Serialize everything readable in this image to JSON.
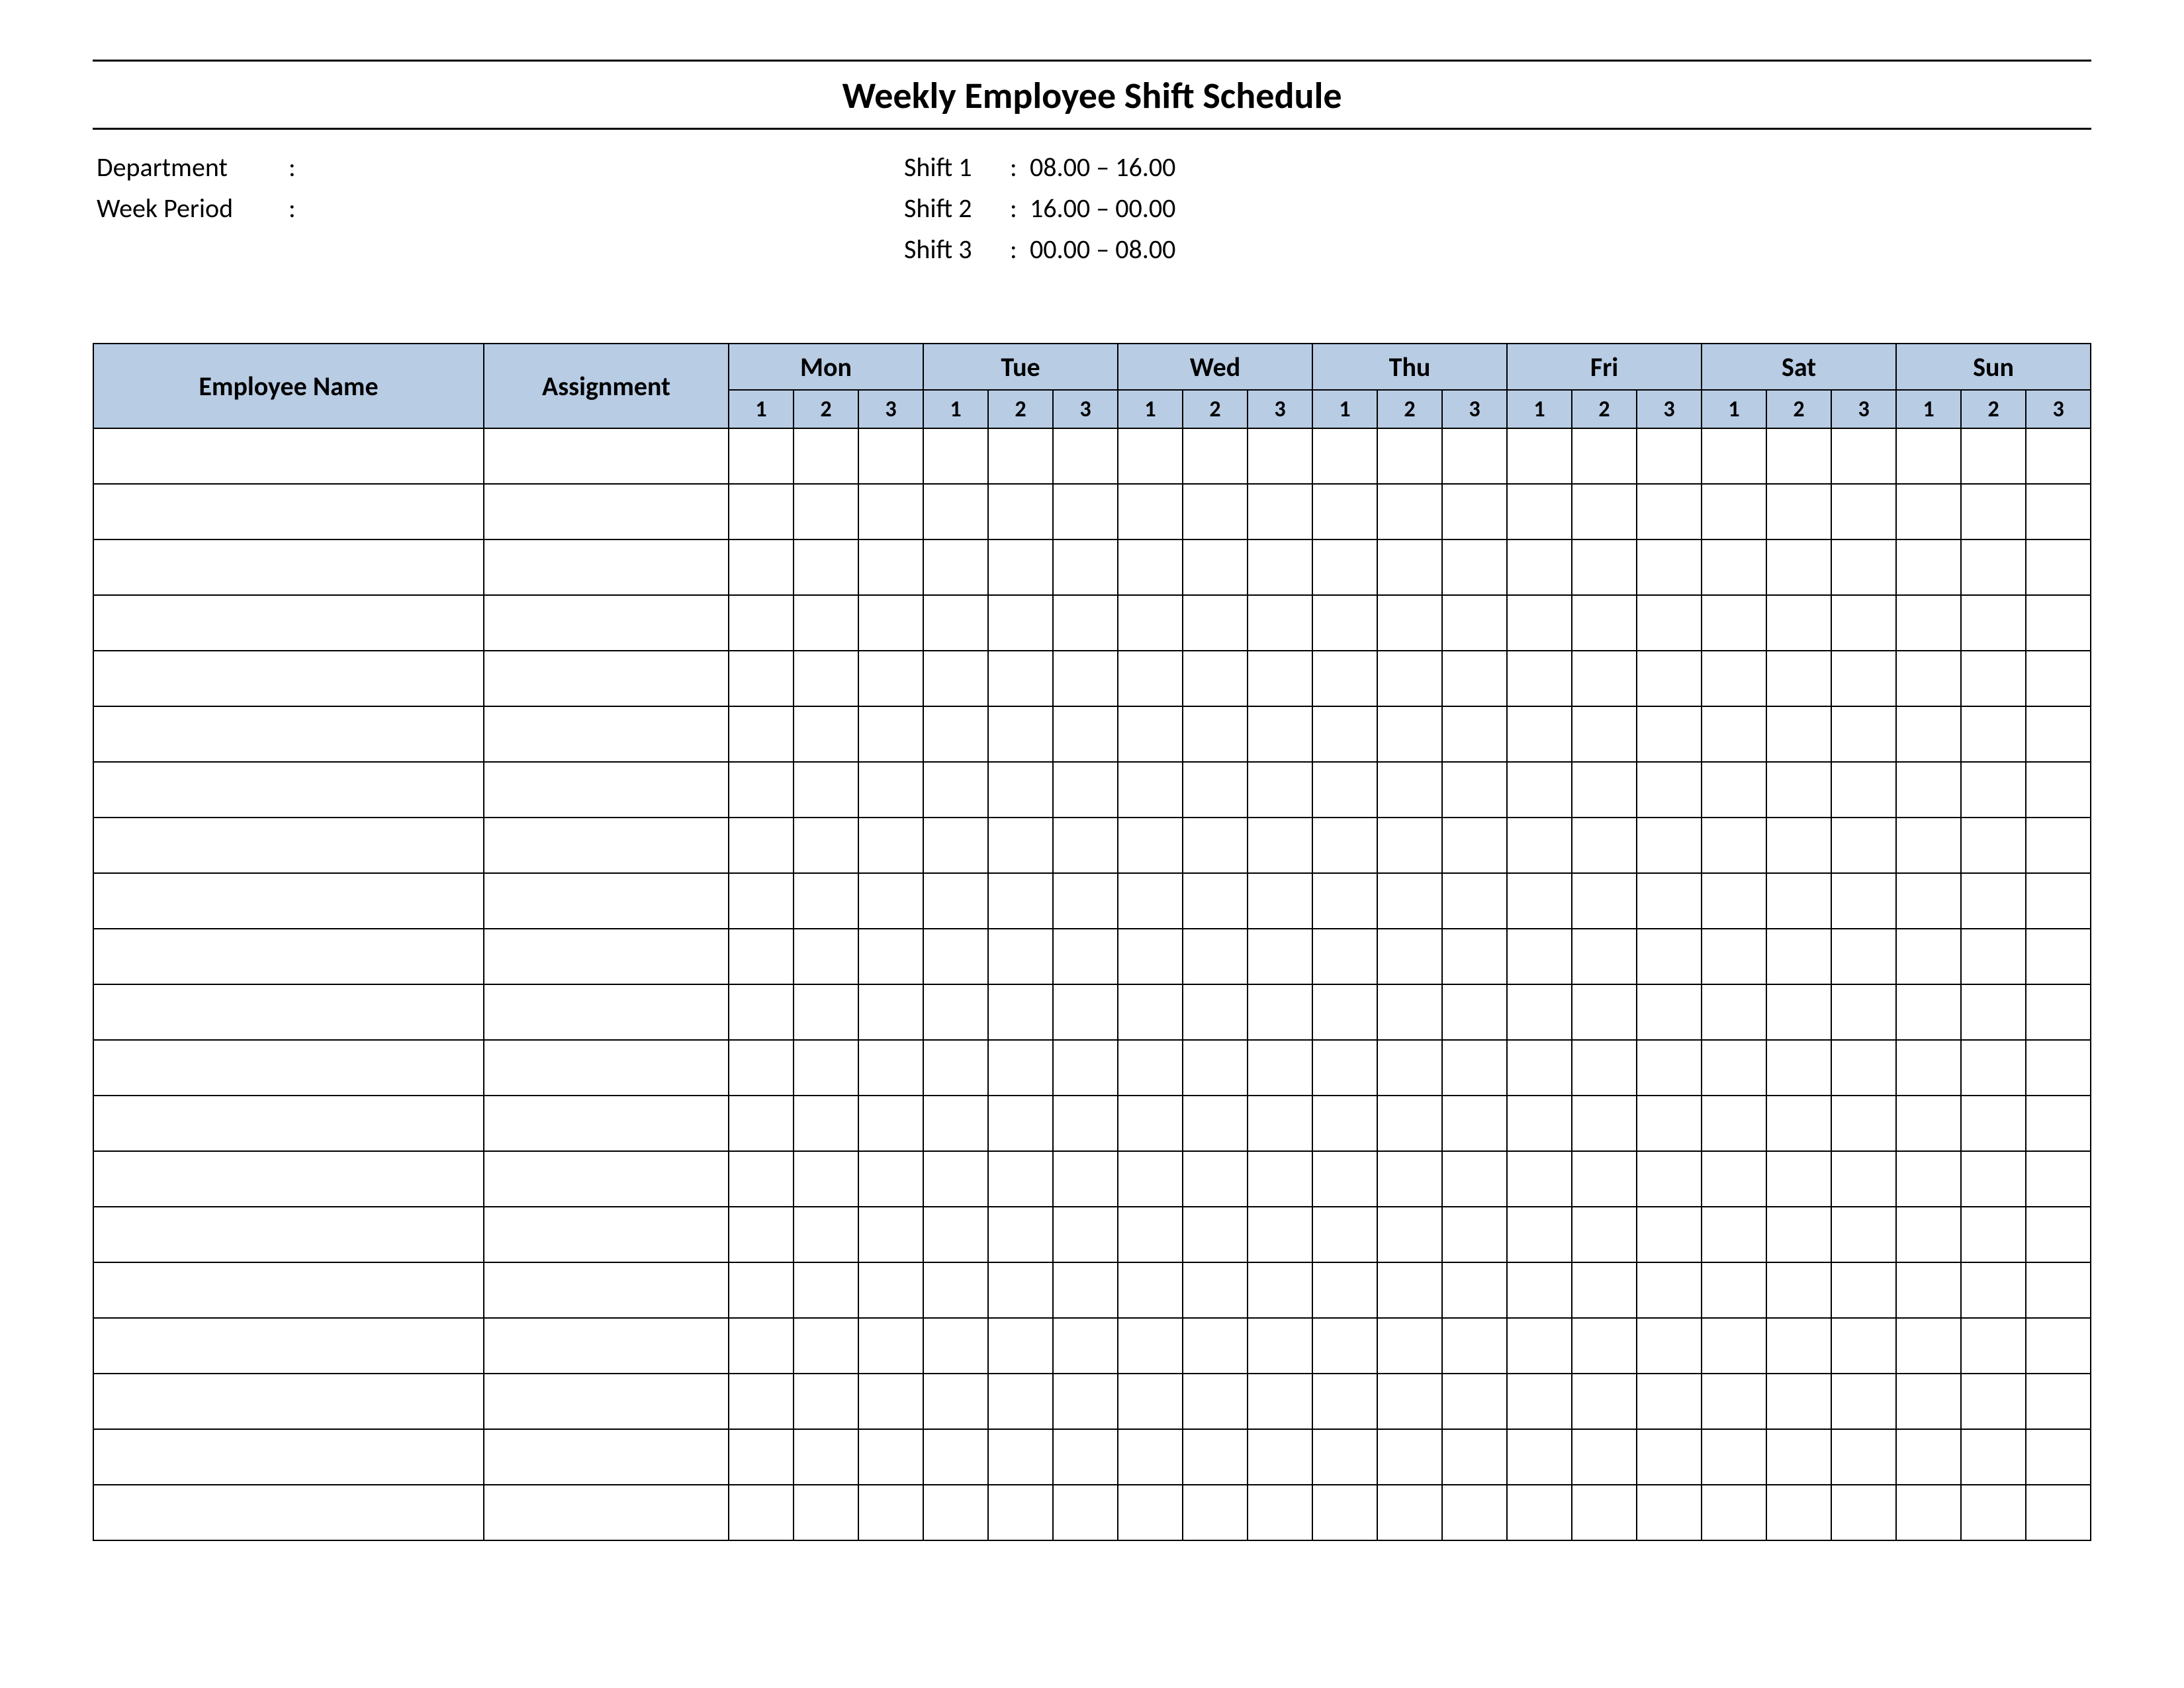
{
  "title": "Weekly Employee Shift Schedule",
  "meta": {
    "department_label": "Department",
    "department_value": "",
    "week_period_label": "Week  Period",
    "week_period_value": "",
    "shifts": [
      {
        "label": "Shift 1",
        "time": "08.00  – 16.00"
      },
      {
        "label": "Shift 2",
        "time": "16.00  – 00.00"
      },
      {
        "label": "Shift 3",
        "time": "00.00  – 08.00"
      }
    ]
  },
  "headers": {
    "employee": "Employee Name",
    "assignment": "Assignment",
    "days": [
      "Mon",
      "Tue",
      "Wed",
      "Thu",
      "Fri",
      "Sat",
      "Sun"
    ],
    "sub": [
      "1",
      "2",
      "3"
    ]
  },
  "rows": 20
}
